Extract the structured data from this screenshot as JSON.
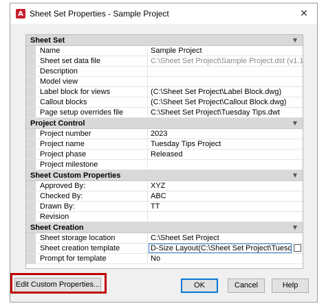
{
  "window": {
    "title": "Sheet Set Properties - Sample Project",
    "close_glyph": "✕",
    "app_icon_letter": "A"
  },
  "groups": [
    {
      "header": "Sheet Set",
      "rows": [
        {
          "name": "Name",
          "value": "Sample Project"
        },
        {
          "name": "Sheet set data file",
          "value": "C:\\Sheet Set Project\\Sample Project.dst (v1.1)",
          "muted": true
        },
        {
          "name": "Description",
          "value": ""
        },
        {
          "name": "Model view",
          "value": ""
        },
        {
          "name": "Label block for views",
          "value": "(C:\\Sheet Set Project\\Label Block.dwg)"
        },
        {
          "name": "Callout blocks",
          "value": "(C:\\Sheet Set Project\\Callout Block.dwg)"
        },
        {
          "name": "Page setup overrides file",
          "value": "C:\\Sheet Set Project\\Tuesday Tips.dwt"
        }
      ]
    },
    {
      "header": "Project Control",
      "rows": [
        {
          "name": "Project number",
          "value": "2023"
        },
        {
          "name": "Project name",
          "value": "Tuesday Tips Project"
        },
        {
          "name": "Project phase",
          "value": "Released"
        },
        {
          "name": "Project milestone",
          "value": ""
        }
      ]
    },
    {
      "header": "Sheet Custom Properties",
      "rows": [
        {
          "name": "Approved By:",
          "value": "XYZ"
        },
        {
          "name": "Checked By:",
          "value": "ABC"
        },
        {
          "name": "Drawn By:",
          "value": "TT"
        },
        {
          "name": "Revision",
          "value": ""
        }
      ]
    },
    {
      "header": "Sheet Creation",
      "rows": [
        {
          "name": "Sheet storage location",
          "value": "C:\\Sheet Set Project"
        },
        {
          "name": "Sheet creation template",
          "value": "D-Size Layout(C:\\Sheet Set Project\\Tuesday Tips.dwt)",
          "selected": true
        },
        {
          "name": "Prompt for template",
          "value": "No"
        }
      ]
    }
  ],
  "buttons": {
    "edit_custom": "Edit Custom Properties...",
    "ok": "OK",
    "cancel": "Cancel",
    "help": "Help"
  },
  "colors": {
    "highlight": "#c00000",
    "accent": "#0078d7"
  }
}
